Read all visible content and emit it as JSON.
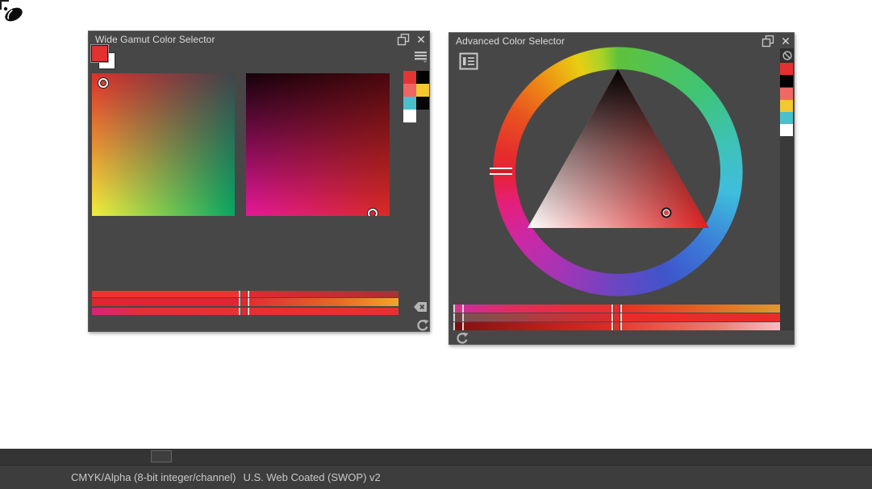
{
  "status_bar": {
    "color_mode": "CMYK/Alpha (8-bit integer/channel)",
    "color_profile": "U.S. Web Coated (SWOP) v2"
  },
  "icons": {
    "close": "✕"
  },
  "wide_gamut": {
    "title": "Wide Gamut Color Selector",
    "foreground_color": "#e03231",
    "background_color": "#ffffff",
    "history_colors": [
      "#e23534",
      "#000000",
      "#f06561",
      "#f3c831",
      "#4ac0cc",
      "#040604",
      "#ffffff"
    ]
  },
  "advanced": {
    "title": "Advanced Color Selector",
    "history_colors": [
      "#e23130",
      "#000000",
      "#f06965",
      "#f3c831",
      "#4ac0cc",
      "#ffffff"
    ]
  }
}
